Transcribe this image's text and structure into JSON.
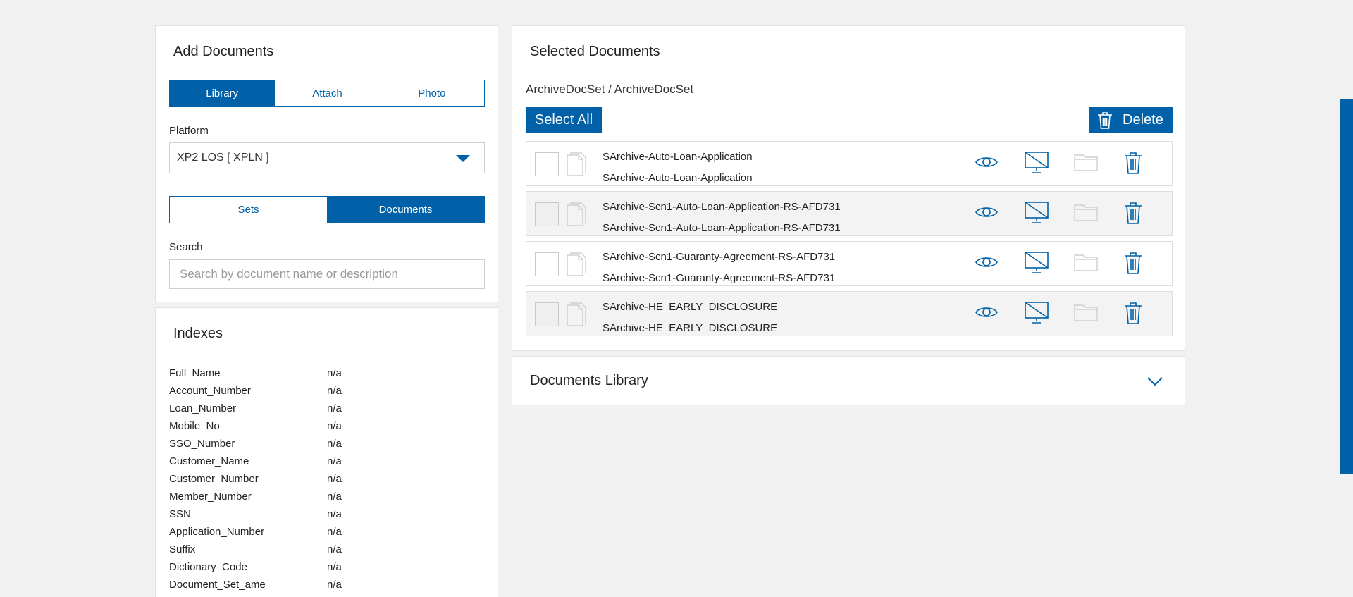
{
  "add_documents": {
    "title": "Add Documents",
    "source_tabs": [
      {
        "label": "Library",
        "active": true
      },
      {
        "label": "Attach",
        "active": false
      },
      {
        "label": "Photo",
        "active": false
      }
    ],
    "platform_label": "Platform",
    "platform_value": "XP2 LOS [ XPLN ]",
    "view_tabs": [
      {
        "label": "Sets",
        "active": false
      },
      {
        "label": "Documents",
        "active": true
      }
    ],
    "search_label": "Search",
    "search_placeholder": "Search by document name or description"
  },
  "indexes": {
    "title": "Indexes",
    "rows": [
      {
        "key": "Full_Name",
        "value": "n/a"
      },
      {
        "key": "Account_Number",
        "value": "n/a"
      },
      {
        "key": "Loan_Number",
        "value": "n/a"
      },
      {
        "key": "Mobile_No",
        "value": "n/a"
      },
      {
        "key": "SSO_Number",
        "value": "n/a"
      },
      {
        "key": "Customer_Name",
        "value": "n/a"
      },
      {
        "key": "Customer_Number",
        "value": "n/a"
      },
      {
        "key": "Member_Number",
        "value": "n/a"
      },
      {
        "key": "SSN",
        "value": "n/a"
      },
      {
        "key": "Application_Number",
        "value": "n/a"
      },
      {
        "key": "Suffix",
        "value": "n/a"
      },
      {
        "key": "Dictionary_Code",
        "value": "n/a"
      },
      {
        "key": "Document_Set_ame",
        "value": "n/a"
      }
    ]
  },
  "selected_documents": {
    "title": "Selected Documents",
    "breadcrumb": "ArchiveDocSet / ArchiveDocSet",
    "select_all_label": "Select All",
    "delete_label": "Delete",
    "documents": [
      {
        "name": "SArchive-Auto-Loan-Application",
        "description": "SArchive-Auto-Loan-Application"
      },
      {
        "name": "SArchive-Scn1-Auto-Loan-Application-RS-AFD731",
        "description": "SArchive-Scn1-Auto-Loan-Application-RS-AFD731"
      },
      {
        "name": "SArchive-Scn1-Guaranty-Agreement-RS-AFD731",
        "description": "SArchive-Scn1-Guaranty-Agreement-RS-AFD731"
      },
      {
        "name": "SArchive-HE_EARLY_DISCLOSURE",
        "description": "SArchive-HE_EARLY_DISCLOSURE"
      }
    ]
  },
  "documents_library": {
    "title": "Documents Library"
  },
  "colors": {
    "accent": "#0061a8",
    "background": "#f1f1f1",
    "row_alt": "#f3f3f3"
  }
}
